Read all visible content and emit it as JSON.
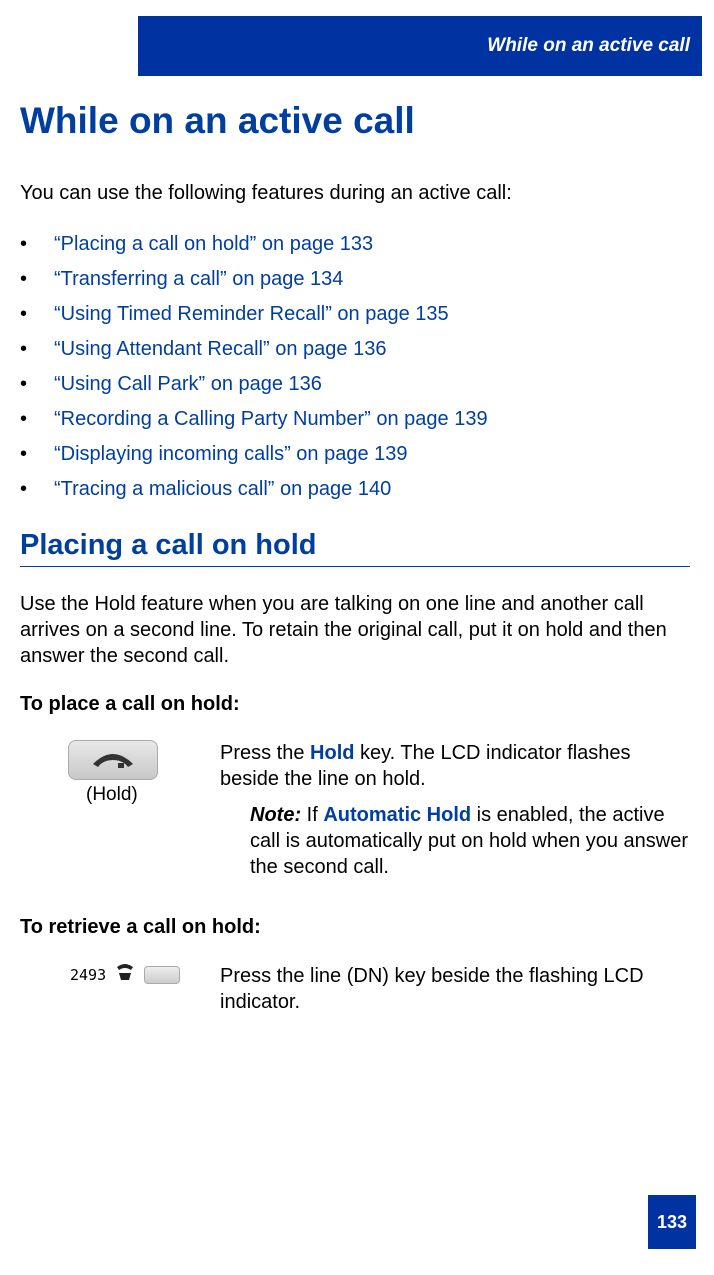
{
  "header": {
    "title": "While on an active call"
  },
  "main": {
    "h1": "While on an active call",
    "intro": "You can use the following features during an active call:",
    "toc": [
      "“Placing a call on hold” on page 133",
      "“Transferring a call” on page 134",
      "“Using Timed Reminder Recall” on page 135",
      "“Using Attendant Recall” on page 136",
      "“Using Call Park” on page 136",
      "“Recording a Calling Party Number” on page 139",
      "“Displaying incoming calls” on page 139",
      "“Tracing a malicious call” on page 140"
    ],
    "h2": "Placing a call on hold",
    "para": "Use the Hold feature when you are talking on one line and another call arrives on a second line. To retain the original call, put it on hold and then answer the second call.",
    "place_hold_heading": "To place a call on hold:",
    "hold_label": "(Hold)",
    "hold_step_pre": "Press the ",
    "hold_step_key": "Hold",
    "hold_step_post": " key. The LCD indicator flashes beside the line on hold.",
    "note_label": "Note:",
    "note_pre": " If ",
    "note_key": "Automatic Hold",
    "note_post": " is enabled, the active call is automatically put on hold when you answer the second call.",
    "retrieve_hold_heading": "To retrieve a call on hold:",
    "dn_number": "2493",
    "retrieve_step": "Press the line (DN) key beside the flashing LCD indicator."
  },
  "page_number": "133"
}
